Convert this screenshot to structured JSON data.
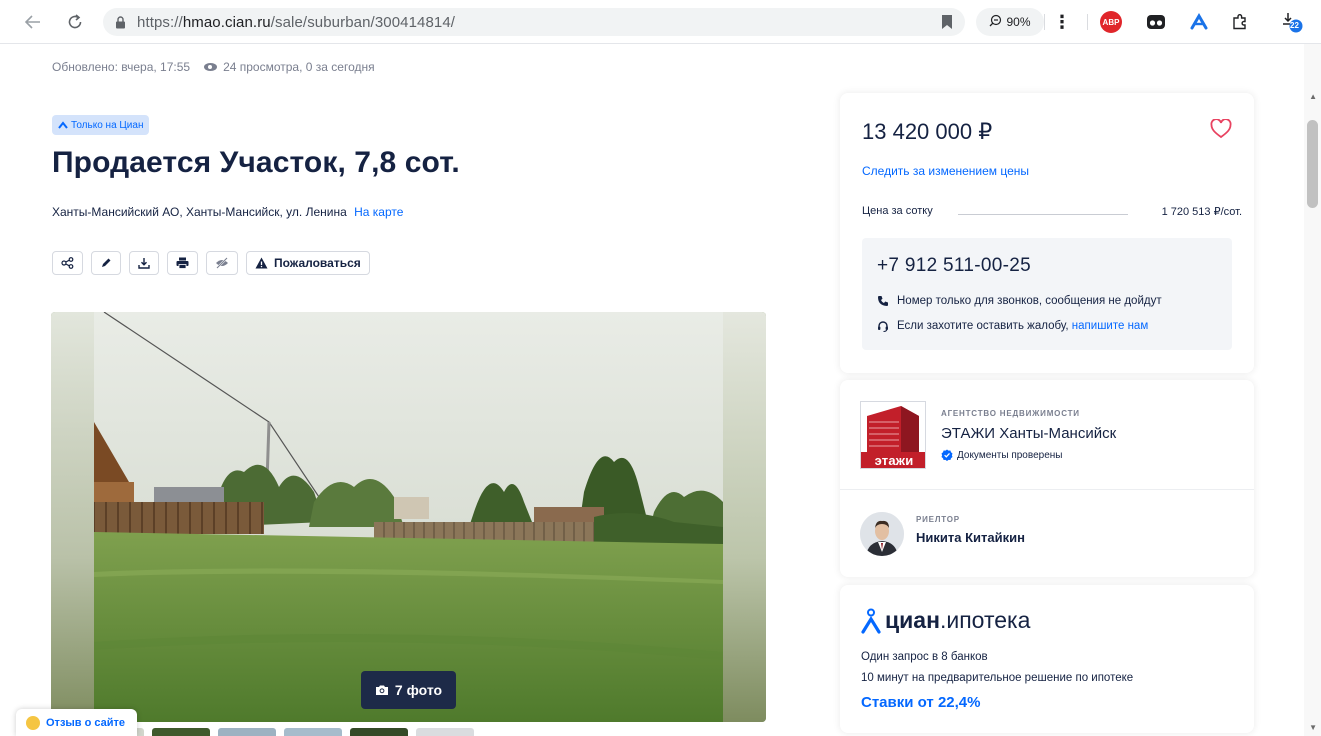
{
  "browser": {
    "url_prefix": "https://",
    "url_host": "hmao.cian.ru",
    "url_path": "/sale/suburban/300414814/",
    "zoom": "90%",
    "abp_label": "ABP",
    "downloads_count": "22"
  },
  "meta": {
    "updated": "Обновлено: вчера, 17:55",
    "views": "24 просмотра, 0 за сегодня"
  },
  "badge": "Только на Циан",
  "title": "Продается Участок, 7,8 сот.",
  "address": {
    "text": "Ханты-Мансийский АО, Ханты-Мансийск, ул. Ленина",
    "map_link": "На карте"
  },
  "actions": {
    "complain_label": "Пожаловаться"
  },
  "gallery": {
    "photo_count": "7 фото"
  },
  "feedback_label": "Отзыв о сайте",
  "price_card": {
    "price": "13 420 000 ₽",
    "follow_link": "Следить за изменением цены",
    "price_per_unit_label": "Цена за сотку",
    "price_per_unit_value": "1 720 513 ₽/сот.",
    "phone": "+7 912 511-00-25",
    "note_calls": "Номер только для звонков, сообщения не дойдут",
    "note_complaint": "Если захотите оставить жалобу,",
    "note_complaint_link": "напишите нам"
  },
  "agent_card": {
    "logo_text": "этажи",
    "type": "АГЕНТСТВО НЕДВИЖИМОСТИ",
    "name": "ЭТАЖИ Ханты-Мансийск",
    "verified": "Документы проверены",
    "realtor_type": "РИЕЛТОР",
    "realtor_name": "Никита Китайкин"
  },
  "mortgage_card": {
    "logo_bold": "циан",
    "logo_rest": ".ипотека",
    "line1": "Один запрос в 8 банков",
    "line2": "10 минут на предварительное решение по ипотеке",
    "rate_link": "Ставки от 22,4%"
  },
  "colors": {
    "accent": "#0468ff",
    "text": "#152242",
    "muted": "#7a7f8f",
    "brand_red": "#c21f2a"
  }
}
